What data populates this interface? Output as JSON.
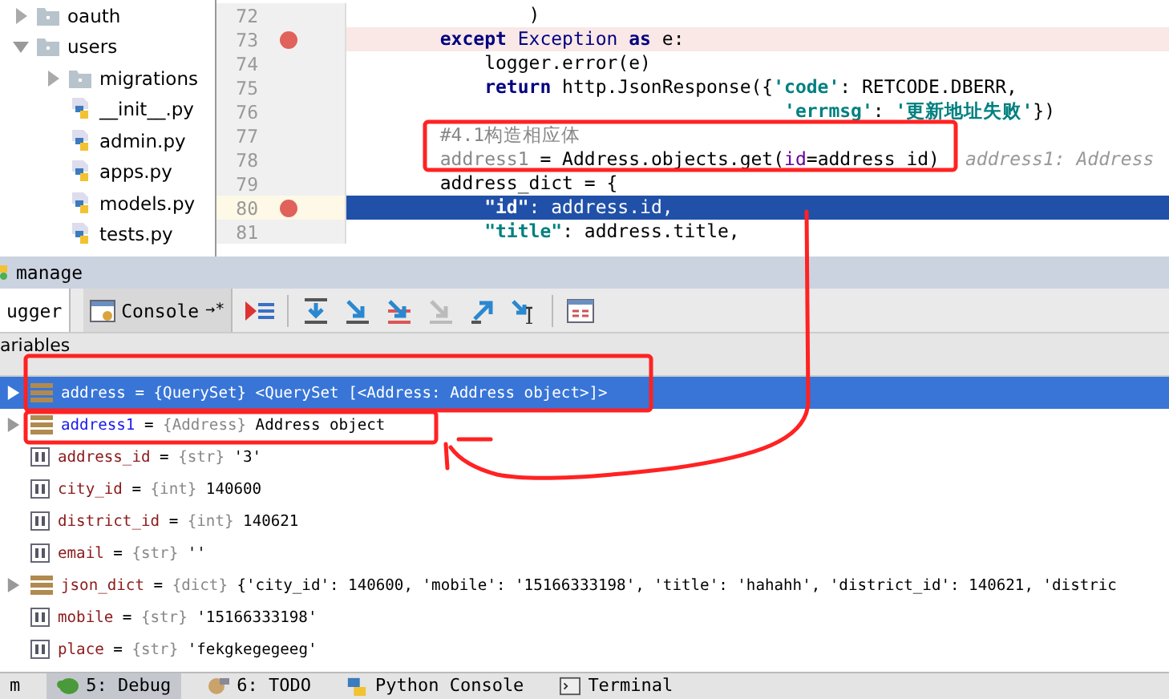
{
  "project_tree": [
    {
      "label": "oauth",
      "kind": "folder",
      "expanded": false
    },
    {
      "label": "users",
      "kind": "folder",
      "expanded": true,
      "children": [
        {
          "label": "migrations",
          "kind": "folder",
          "expanded": false
        },
        {
          "label": "__init__.py",
          "kind": "python"
        },
        {
          "label": "admin.py",
          "kind": "python"
        },
        {
          "label": "apps.py",
          "kind": "python"
        },
        {
          "label": "models.py",
          "kind": "python"
        },
        {
          "label": "tests.py",
          "kind": "python"
        }
      ]
    }
  ],
  "editor": {
    "lines": [
      {
        "number": "72",
        "breakpoint": false,
        "selected": false,
        "tokens": [
          {
            "kind": "plain",
            "text": "                )"
          }
        ]
      },
      {
        "number": "73",
        "breakpoint": true,
        "selected": false,
        "tokens": [
          {
            "kind": "keyword",
            "text": "        except"
          },
          {
            "kind": "class",
            "text": " Exception "
          },
          {
            "kind": "keyword",
            "text": "as"
          },
          {
            "kind": "plain",
            "text": " e:"
          }
        ]
      },
      {
        "number": "74",
        "breakpoint": false,
        "selected": false,
        "tokens": [
          {
            "kind": "plain",
            "text": "            logger.error(e)"
          }
        ]
      },
      {
        "number": "75",
        "breakpoint": false,
        "selected": false,
        "tokens": [
          {
            "kind": "keyword",
            "text": "            return"
          },
          {
            "kind": "plain",
            "text": " http.JsonResponse({"
          },
          {
            "kind": "string",
            "text": "'code'"
          },
          {
            "kind": "plain",
            "text": ": RETCODE.DBERR,"
          }
        ]
      },
      {
        "number": "76",
        "breakpoint": false,
        "selected": false,
        "tokens": [
          {
            "kind": "string",
            "text": "                                       'errmsg'"
          },
          {
            "kind": "plain",
            "text": ": "
          },
          {
            "kind": "string",
            "text": "'更新地址失败'"
          },
          {
            "kind": "plain",
            "text": "})"
          }
        ]
      },
      {
        "number": "77",
        "breakpoint": false,
        "selected": false,
        "tokens": [
          {
            "kind": "comment",
            "text": "        #4.1构造相应体"
          }
        ]
      },
      {
        "number": "78",
        "breakpoint": false,
        "selected": false,
        "tokens": [
          {
            "kind": "unused",
            "text": "        address1"
          },
          {
            "kind": "plain",
            "text": " = Address.objects.get("
          },
          {
            "kind": "param",
            "text": "id"
          },
          {
            "kind": "plain",
            "text": "=address_id)"
          },
          {
            "kind": "hint",
            "text": "address1: Address"
          }
        ]
      },
      {
        "number": "79",
        "breakpoint": false,
        "selected": false,
        "tokens": [
          {
            "kind": "plain",
            "text": "        address_dict = {"
          }
        ]
      },
      {
        "number": "80",
        "breakpoint": true,
        "selected": true,
        "tokens": [
          {
            "kind": "string",
            "text": "            \"id\""
          },
          {
            "kind": "plain",
            "text": ": address.id,"
          }
        ]
      },
      {
        "number": "81",
        "breakpoint": false,
        "selected": false,
        "tokens": [
          {
            "kind": "string",
            "text": "            \"title\""
          },
          {
            "kind": "plain",
            "text": ": address.title,"
          }
        ]
      }
    ]
  },
  "debug_panel": {
    "title": "manage",
    "tabs": [
      {
        "label": "ugger",
        "selected": true
      },
      {
        "label": "Console",
        "selected": false,
        "pin": "→*"
      }
    ],
    "variables_header": "ariables",
    "assign": "=",
    "variables": [
      {
        "name": "address",
        "type": "{QuerySet}",
        "value": "<QuerySet [<Address: Address object>]>",
        "kind": "object",
        "expandable": true,
        "changed": false,
        "selected": true
      },
      {
        "name": "address1",
        "type": "{Address}",
        "value": "Address object",
        "kind": "object",
        "expandable": true,
        "changed": true,
        "selected": false
      },
      {
        "name": "address_id",
        "type": "{str}",
        "value": "'3'",
        "kind": "primitive",
        "expandable": false,
        "changed": false,
        "selected": false
      },
      {
        "name": "city_id",
        "type": "{int}",
        "value": "140600",
        "kind": "primitive",
        "expandable": false,
        "changed": false,
        "selected": false
      },
      {
        "name": "district_id",
        "type": "{int}",
        "value": "140621",
        "kind": "primitive",
        "expandable": false,
        "changed": false,
        "selected": false
      },
      {
        "name": "email",
        "type": "{str}",
        "value": "''",
        "kind": "primitive",
        "expandable": false,
        "changed": false,
        "selected": false
      },
      {
        "name": "json_dict",
        "type": "{dict}",
        "value": "{'city_id': 140600, 'mobile': '15166333198', 'title': 'hahahh', 'district_id': 140621, 'distric",
        "kind": "object",
        "expandable": true,
        "changed": false,
        "selected": false
      },
      {
        "name": "mobile",
        "type": "{str}",
        "value": "'15166333198'",
        "kind": "primitive",
        "expandable": false,
        "changed": false,
        "selected": false
      },
      {
        "name": "place",
        "type": "{str}",
        "value": "'fekgkegegeeg'",
        "kind": "primitive",
        "expandable": false,
        "changed": false,
        "selected": false
      }
    ]
  },
  "bottom_tabs": [
    {
      "label": "m",
      "kind": "plain",
      "selected": false
    },
    {
      "label": "5: Debug",
      "kind": "debug",
      "selected": true
    },
    {
      "label": "6: TODO",
      "kind": "todo",
      "selected": false
    },
    {
      "label": "Python Console",
      "kind": "python",
      "selected": false
    },
    {
      "label": "Terminal",
      "kind": "terminal",
      "selected": false
    }
  ]
}
